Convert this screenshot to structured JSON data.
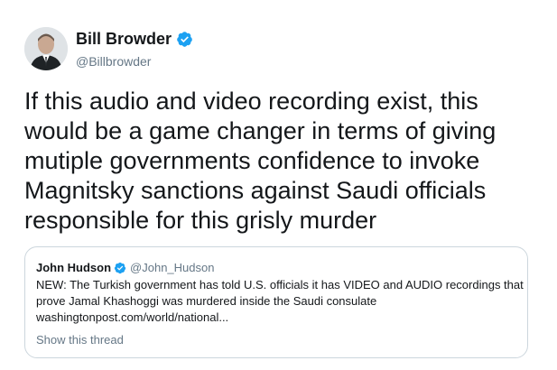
{
  "author": {
    "name": "Bill Browder",
    "handle": "@Billbrowder",
    "avatar_icon": "person-avatar-icon",
    "verified_icon": "verified-badge-icon"
  },
  "tweet": {
    "text": "If this audio and video recording exist, this would be a game changer in terms of giving mutiple governments confidence to invoke Magnitsky sanctions against Saudi officials responsible for this grisly murder"
  },
  "quoted_tweet": {
    "name": "John Hudson",
    "handle": "@John_Hudson",
    "text": "NEW: The Turkish government has told U.S. officials it has VIDEO and AUDIO recordings that prove Jamal Khashoggi was murdered inside the Saudi consulate",
    "link": "washingtonpost.com/world/national...",
    "show_thread": "Show this thread"
  },
  "colors": {
    "accent": "#1da1f2",
    "muted": "#657786",
    "text": "#14171a",
    "border": "#ccd6dd"
  }
}
